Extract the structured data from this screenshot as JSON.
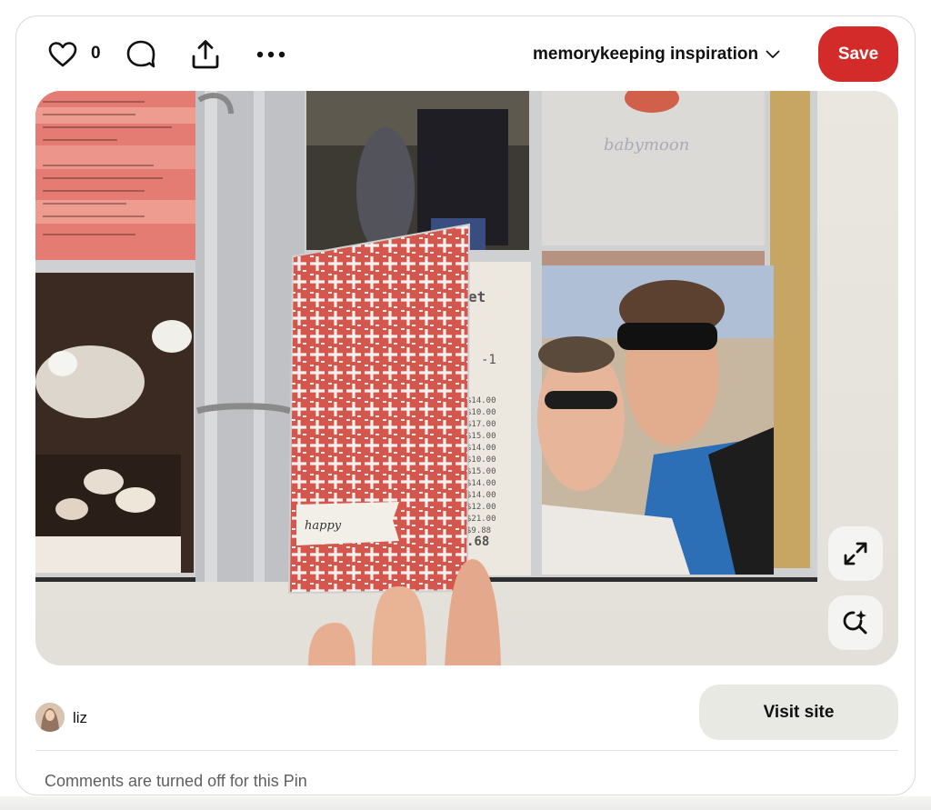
{
  "actions": {
    "like_count": "0"
  },
  "board": {
    "name": "memorykeeping inspiration"
  },
  "buttons": {
    "save_label": "Save",
    "visit_label": "Visit site"
  },
  "pin": {
    "author": "liz",
    "comments_note": "Comments are turned off for this Pin"
  },
  "colors": {
    "save_button": "#d32a2a",
    "visit_button": "#e9e9e4",
    "muted_text": "#5f5f5f"
  },
  "icons": [
    "heart-icon",
    "comment-icon",
    "share-icon",
    "more-icon",
    "chevron-down-icon",
    "expand-icon",
    "visual-search-icon"
  ]
}
